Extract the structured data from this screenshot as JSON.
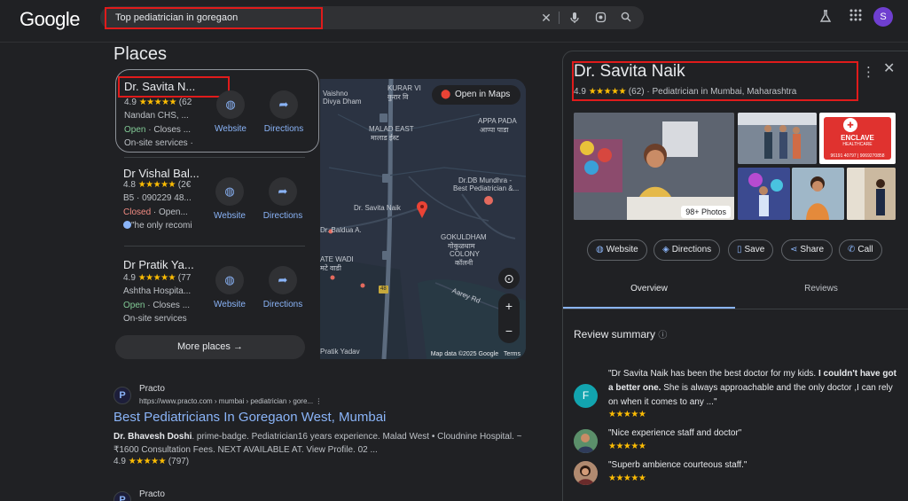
{
  "header": {
    "logo": "Google",
    "search_query": "Top pediatrician in goregaon",
    "avatar_letter": "S"
  },
  "places": {
    "title": "Places",
    "items": [
      {
        "name": "Dr. Savita N...",
        "rating": "4.9",
        "stars": "★★★★★",
        "count": "(62",
        "address": "Nandan CHS, ...",
        "status": "Open",
        "status_detail": " · Closes ...",
        "extra": "On-site services ·",
        "website_label": "Website",
        "directions_label": "Directions"
      },
      {
        "name": "Dr Vishal Bal...",
        "rating": "4.8",
        "stars": "★★★★★",
        "count": "(2€",
        "address": "B5 · 090229 48...",
        "status": "Closed",
        "status_detail": " · Open...",
        "extra": "\"he only recomi",
        "website_label": "Website",
        "directions_label": "Directions"
      },
      {
        "name": "Dr Pratik Ya...",
        "rating": "4.9",
        "stars": "★★★★★",
        "count": "(77",
        "address": "Ashtha Hospita...",
        "status": "Open",
        "status_detail": " · Closes ...",
        "extra": "On-site services",
        "website_label": "Website",
        "directions_label": "Directions"
      }
    ],
    "more_label": "More places"
  },
  "map": {
    "open_in_maps": "Open in Maps",
    "labels": {
      "kurar": "KURAR VI",
      "kurar_hi": "कुरार वि",
      "vaishno": "Vaishno",
      "divya": "Divya Dham",
      "malad_east": "MALAD EAST",
      "malad_east_hi": "मालाड ईस्ट",
      "appa_pada": "APPA PADA",
      "appa_pada_hi": "आप्पा पाडा",
      "mundhra_1": "Dr.DB Mundhra -",
      "mundhra_2": "Best Pediatrician &...",
      "savita": "Dr. Savita Naik",
      "baldua": "Dr. Baldua A.",
      "gokuldham_1": "GOKULDHAM",
      "gokuldham_hi": "गोकुळधाम",
      "colony": "COLONY",
      "colony_hi": "कॉलनी",
      "ate_wadi": "ATE WADI",
      "ate_wadi_hi": "मटे वाडी",
      "aarey": "Aarey Rd",
      "pratik": "Pratik Yadav",
      "road_no": "48"
    },
    "attribution": "Map data ©2025 Google",
    "terms": "Terms"
  },
  "results": [
    {
      "site": "Practo",
      "url": "https://www.practo.com › mumbai › pediatrician › gore...",
      "menu": "⋮",
      "title": "Best Pediatricians In Goregaon West, Mumbai",
      "snippet_bold": "Dr. Bhavesh Doshi",
      "snippet": ". prime-badge. Pediatrician16 years experience. Malad West • Cloudnine Hospital. ~ ₹1600 Consultation Fees. NEXT AVAILABLE AT. View Profile. 02 ...",
      "rating": "4.9",
      "stars": "★★★★★",
      "count": "(797)"
    },
    {
      "site": "Practo"
    }
  ],
  "knowledge_panel": {
    "title": "Dr. Savita Naik",
    "rating": "4.9",
    "stars": "★★★★★",
    "count": "(62)",
    "category": "Pediatrician in Mumbai, Maharashtra",
    "photos_badge": "98+ Photos",
    "clinic_sign_1": "ENCLAVE",
    "clinic_sign_2": "HEALTHCARE",
    "clinic_phone": "96191 40797 | 9069270858",
    "actions": {
      "website": "Website",
      "directions": "Directions",
      "save": "Save",
      "share": "Share",
      "call": "Call"
    },
    "tabs": {
      "overview": "Overview",
      "reviews": "Reviews"
    },
    "review_summary_title": "Review summary",
    "reviews": [
      {
        "avatar_letter": "F",
        "avatar_color": "#12a4af",
        "text_a": "\"Dr Savita Naik has been the best doctor for my kids. ",
        "text_bold": "I couldn't have got a better one.",
        "text_b": " She is always approachable and the only doctor ,I can rely on when it comes to any ...\"",
        "stars": "★★★★★"
      },
      {
        "text_a": "\"Nice experience staff and doctor\"",
        "stars": "★★★★★"
      },
      {
        "text_a": "\"Superb ambience courteous staff.\"",
        "stars": "★★★★★"
      }
    ]
  },
  "colors": {
    "background": "#202124",
    "link": "#8ab4f8",
    "star": "#fbbc04",
    "open": "#81c995",
    "closed": "#f28b82",
    "annotation_box": "#e01b1b"
  }
}
